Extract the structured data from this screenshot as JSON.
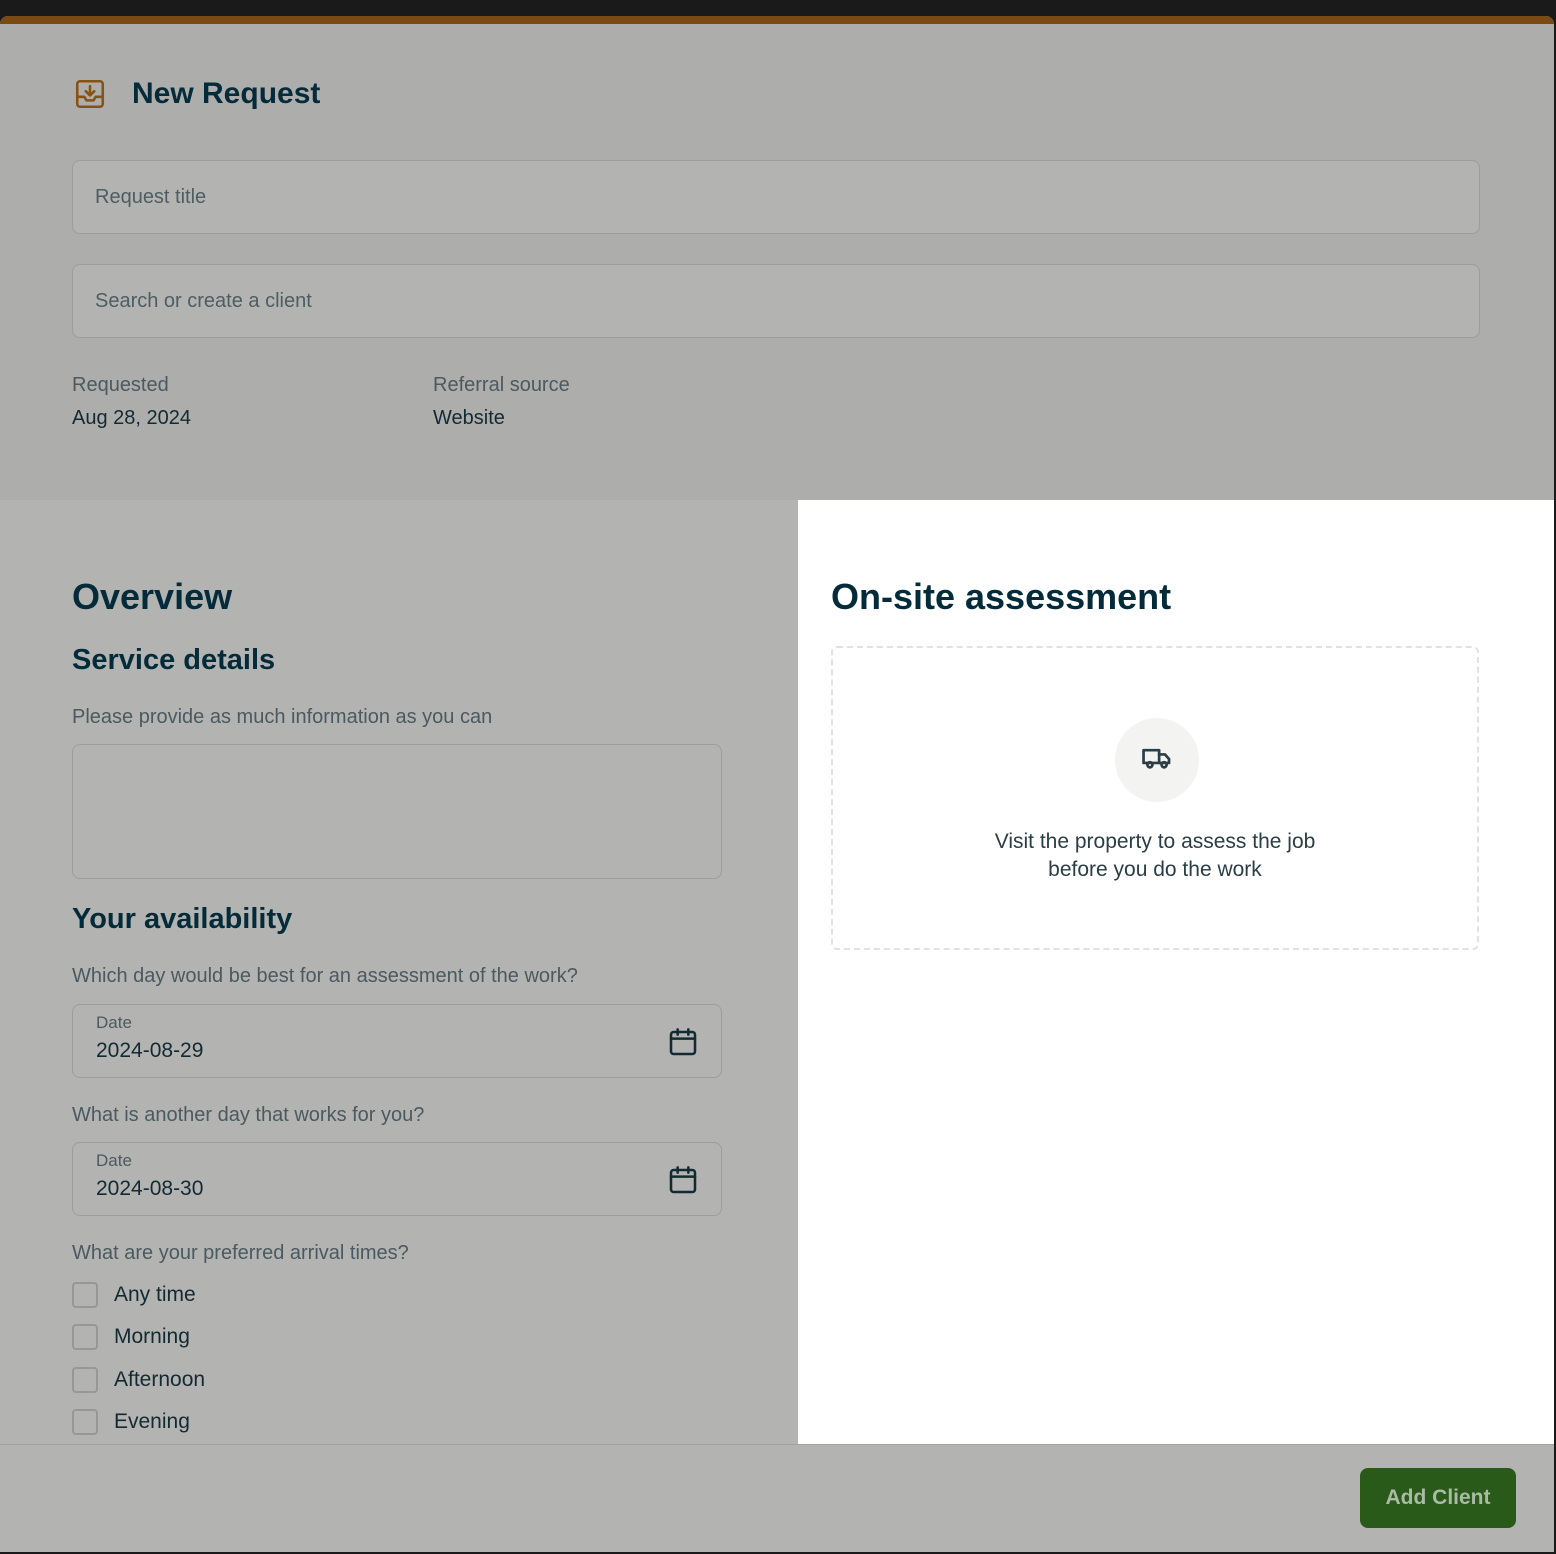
{
  "header": {
    "title": "New Request",
    "icon": "inbox-download-icon",
    "accent_color": "#7a4a12"
  },
  "form": {
    "title_placeholder": "Request title",
    "client_placeholder": "Search or create a client"
  },
  "meta": {
    "requested_label": "Requested",
    "requested_value": "Aug 28, 2024",
    "referral_label": "Referral source",
    "referral_value": "Website"
  },
  "overview": {
    "heading": "Overview",
    "service_heading": "Service details",
    "service_helper": "Please provide as much information as you can",
    "availability_heading": "Your availability",
    "q1": "Which day would be best for an assessment of the work?",
    "date1_label": "Date",
    "date1_value": "2024-08-29",
    "q2": "What is another day that works for you?",
    "date2_label": "Date",
    "date2_value": "2024-08-30",
    "q3": "What are your preferred arrival times?",
    "arrival_options": [
      "Any time",
      "Morning",
      "Afternoon",
      "Evening"
    ]
  },
  "onsite": {
    "heading": "On-site assessment",
    "icon": "truck-icon",
    "text_line1": "Visit the property to assess the job",
    "text_line2": "before you do the work"
  },
  "footer": {
    "add_client_label": "Add Client",
    "button_color": "#2a5a19"
  }
}
